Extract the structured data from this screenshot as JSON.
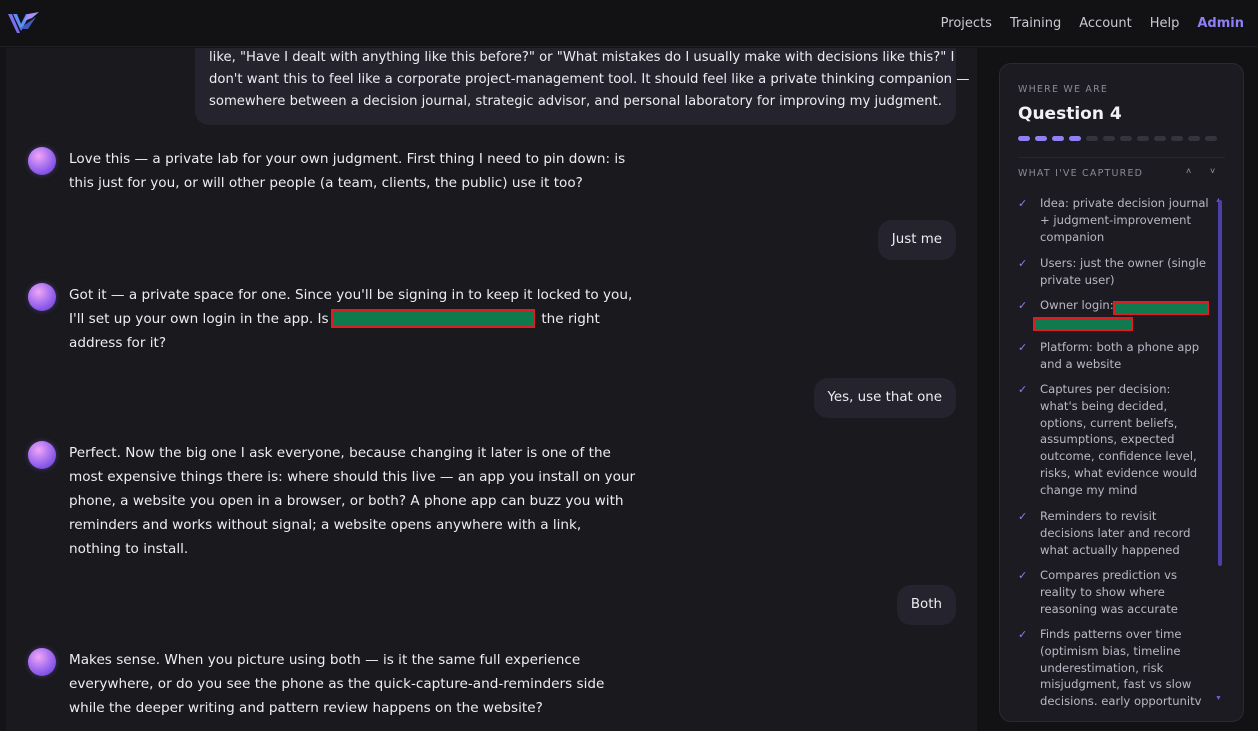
{
  "nav": {
    "logo_icon": "v-logo-icon",
    "links": [
      "Projects",
      "Training",
      "Account",
      "Help",
      "Admin"
    ],
    "active": "Admin",
    "accent_color": "#8d7ff5"
  },
  "chat": {
    "messages": [
      {
        "role": "user",
        "lines": [
          "like, \"Have I dealt with anything like this before?\" or \"What mistakes do I usually make with decisions like this?\" I",
          "don't want this to feel like a corporate project-management tool. It should feel like a private thinking companion —",
          "somewhere between a decision journal, strategic advisor, and personal laboratory for improving my judgment."
        ]
      },
      {
        "role": "assistant",
        "lines": [
          "Love this — a private lab for your own judgment. First thing I need to pin down: is",
          "this just for you, or will other people (a team, clients, the public) use it too?"
        ]
      },
      {
        "role": "user",
        "text": "Just me"
      },
      {
        "role": "assistant",
        "lines": [
          "Got it — a private space for one. Since you'll be signing in to keep it locked to you,",
          "I'll set up your own login in the app. Is",
          "the right",
          "address for it?"
        ]
      },
      {
        "role": "user",
        "text": "Yes, use that one"
      },
      {
        "role": "assistant",
        "lines": [
          "Perfect. Now the big one I ask everyone, because changing it later is one of the",
          "most expensive things there is: where should this live — an app you install on your",
          "phone, a website you open in a browser, or both? A phone app can buzz you with",
          "reminders and works without signal; a website opens anywhere with a link,",
          "nothing to install."
        ]
      },
      {
        "role": "user",
        "text": "Both"
      },
      {
        "role": "assistant",
        "lines": [
          "Makes sense. When you picture using both — is it the same full experience",
          "everywhere, or do you see the phone as the quick-capture-and-reminders side",
          "while the deeper writing and pattern review happens on the website?"
        ]
      }
    ]
  },
  "panel": {
    "eyebrow": "WHERE WE ARE",
    "title": "Question 4",
    "progress": {
      "current": 4,
      "total": 12
    },
    "captured_label": "WHAT I'VE CAPTURED",
    "items": [
      {
        "lines": [
          "Idea: private decision journal",
          "+ judgment-improvement",
          "companion"
        ]
      },
      {
        "lines": [
          "Users: just the owner (single",
          "private user)"
        ]
      },
      {
        "lines": [
          "Owner login:"
        ],
        "redacted": true
      },
      {
        "lines": [
          "Platform: both a phone app",
          "and a website"
        ]
      },
      {
        "lines": [
          "Captures per decision:",
          "what's being decided,",
          "options, current beliefs,",
          "assumptions, expected",
          "outcome, confidence level,",
          "risks, what evidence would",
          "change my mind"
        ]
      },
      {
        "lines": [
          "Reminders to revisit",
          "decisions later and record",
          "what actually happened"
        ]
      },
      {
        "lines": [
          "Compares prediction vs",
          "reality to show where",
          "reasoning was accurate"
        ]
      },
      {
        "lines": [
          "Finds patterns over time",
          "(optimism bias, timeline",
          "underestimation, risk",
          "misjudgment, fast vs slow",
          "decisions. early opportunitv"
        ]
      }
    ]
  }
}
